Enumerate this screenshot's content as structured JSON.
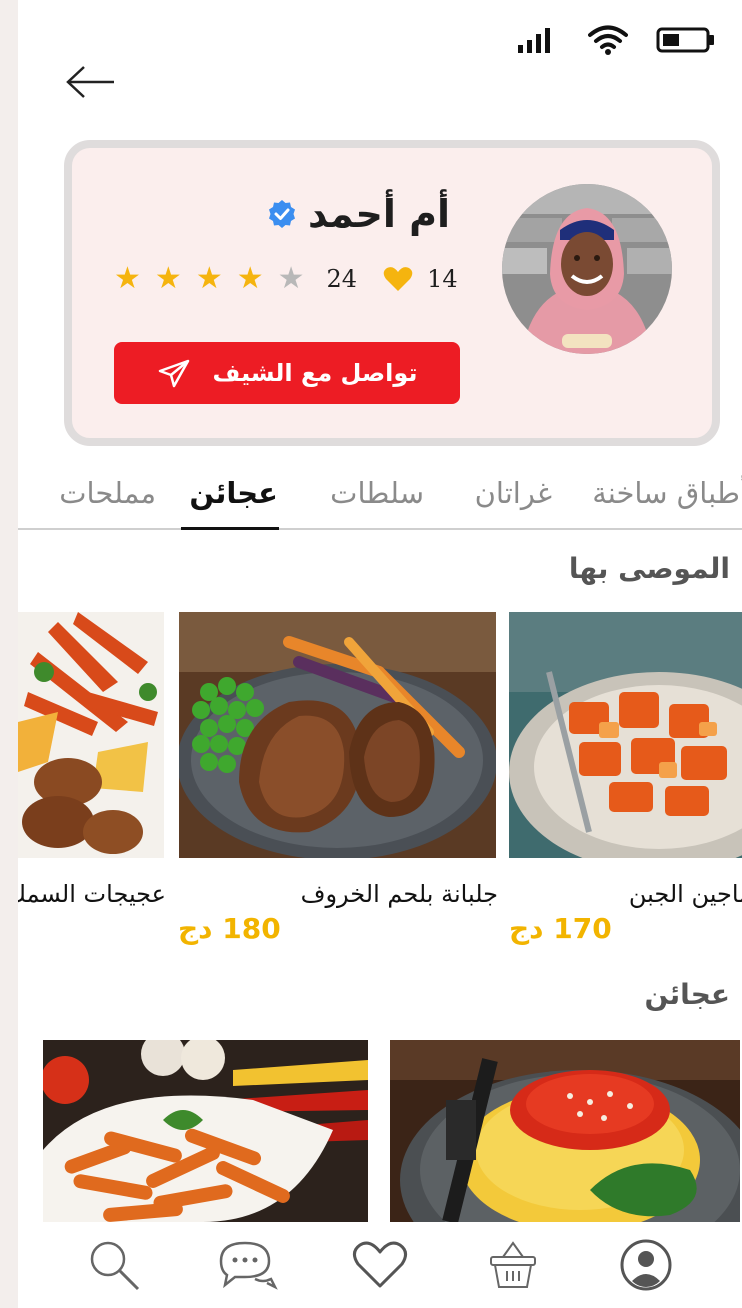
{
  "colors": {
    "accent": "#ed1c24",
    "price": "#f2b400",
    "star": "#f5b40f",
    "verified": "#3b8ef0",
    "card_bg": "#fbeeed"
  },
  "icons": {
    "status": [
      "signal-icon",
      "wifi-icon",
      "battery-icon"
    ],
    "back": "back-arrow-icon",
    "nav": [
      "search-icon",
      "chat-icon",
      "heart-icon",
      "basket-icon",
      "profile-icon"
    ]
  },
  "chef": {
    "name": "أم أحمد",
    "likes": "14",
    "rating_count": "24",
    "rating": 4,
    "rating_max": 5,
    "contact_label": "تواصل مع الشيف"
  },
  "tabs": [
    {
      "label": "أطباق ساخنة",
      "active": false
    },
    {
      "label": "غراتان",
      "active": false
    },
    {
      "label": "سلطات",
      "active": false
    },
    {
      "label": "عجائن",
      "active": true
    },
    {
      "label": "مملحات",
      "active": false
    }
  ],
  "recommended": {
    "title": "الموصى بها",
    "items": [
      {
        "name": "ماجين الجبن",
        "price": "170 دج"
      },
      {
        "name": "جلبانة بلحم الخروف",
        "price": "180 دج"
      },
      {
        "name": "عجيجات السمك",
        "price": ""
      }
    ]
  },
  "pasta": {
    "title": "عجائن"
  }
}
